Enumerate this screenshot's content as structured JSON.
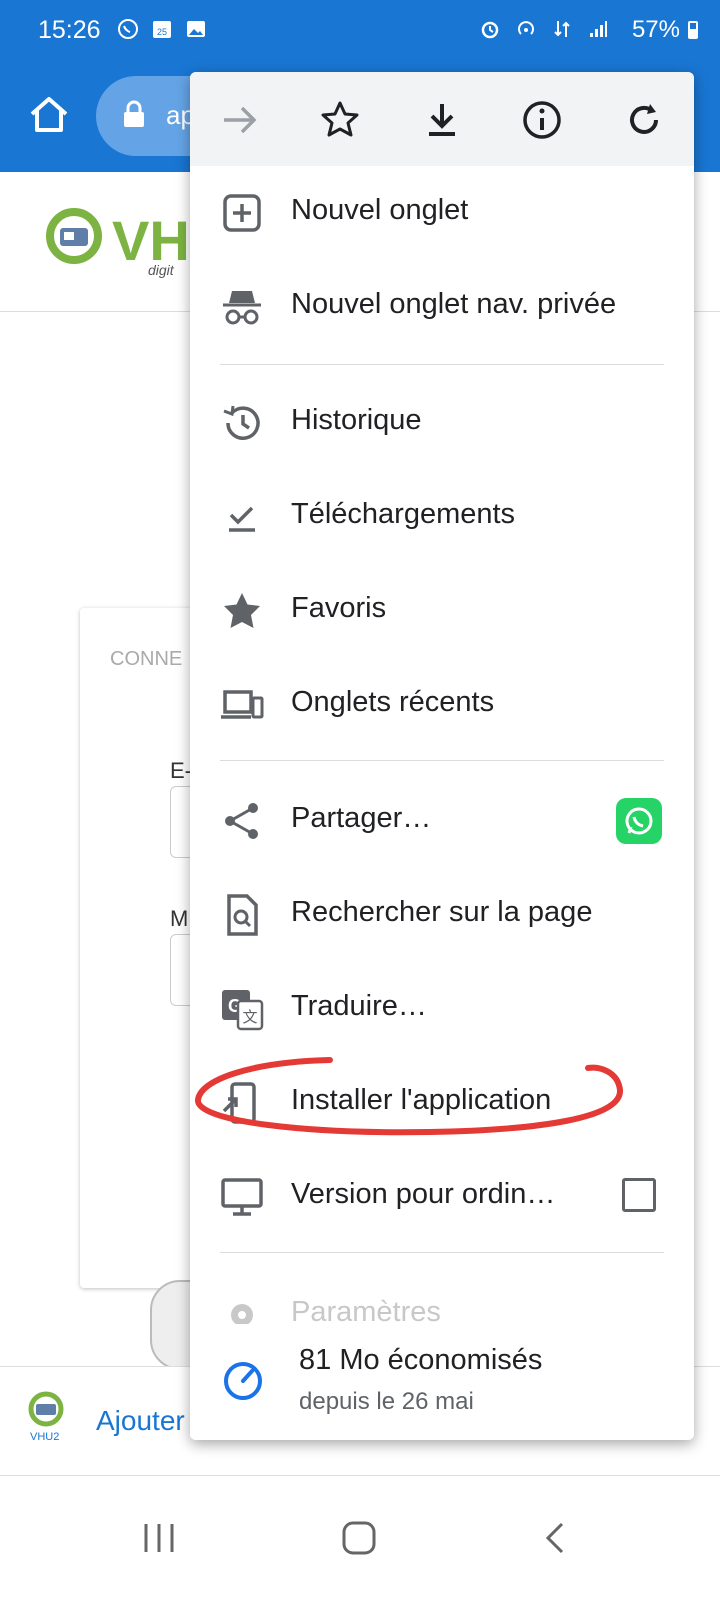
{
  "status_bar": {
    "time": "15:26",
    "battery_percent": "57%",
    "left_icons": [
      "whatsapp-icon",
      "calendar-icon",
      "gallery-icon"
    ],
    "right_icons": [
      "alarm-icon",
      "hotspot-icon",
      "data-signal-icon",
      "signal-icon"
    ]
  },
  "toolbar": {
    "url_partial": "ap"
  },
  "page": {
    "logo_text": "VH",
    "logo_sub": "digit",
    "login_title": "CONNE",
    "email_label_partial": "E-",
    "password_label_partial": "M",
    "banner_text": "Ajouter",
    "banner_logo_text": "VHU2"
  },
  "menu": {
    "top_icons": [
      "forward-icon",
      "bookmark-star-icon",
      "download-icon",
      "info-icon",
      "reload-icon"
    ],
    "items": [
      {
        "label": "Nouvel onglet",
        "icon": "new-tab-icon"
      },
      {
        "label": "Nouvel onglet nav. privée",
        "icon": "incognito-icon"
      },
      {
        "label": "Historique",
        "icon": "history-icon"
      },
      {
        "label": "Téléchargements",
        "icon": "downloads-icon"
      },
      {
        "label": "Favoris",
        "icon": "bookmarks-star-icon"
      },
      {
        "label": "Onglets récents",
        "icon": "recent-tabs-icon"
      },
      {
        "label": "Partager…",
        "icon": "share-icon"
      },
      {
        "label": "Rechercher sur la page",
        "icon": "find-in-page-icon"
      },
      {
        "label": "Traduire…",
        "icon": "translate-icon"
      },
      {
        "label": "Installer l'application",
        "icon": "install-app-icon"
      },
      {
        "label": "Version pour ordin…",
        "icon": "desktop-icon"
      },
      {
        "label": "Paramètres",
        "icon": "settings-icon"
      }
    ],
    "savings_title": "81 Mo économisés",
    "savings_subtitle": "depuis le 26 mai"
  },
  "colors": {
    "toolbar_blue": "#1976d2",
    "annotation_red": "#e53935",
    "whatsapp_green": "#25d366"
  }
}
